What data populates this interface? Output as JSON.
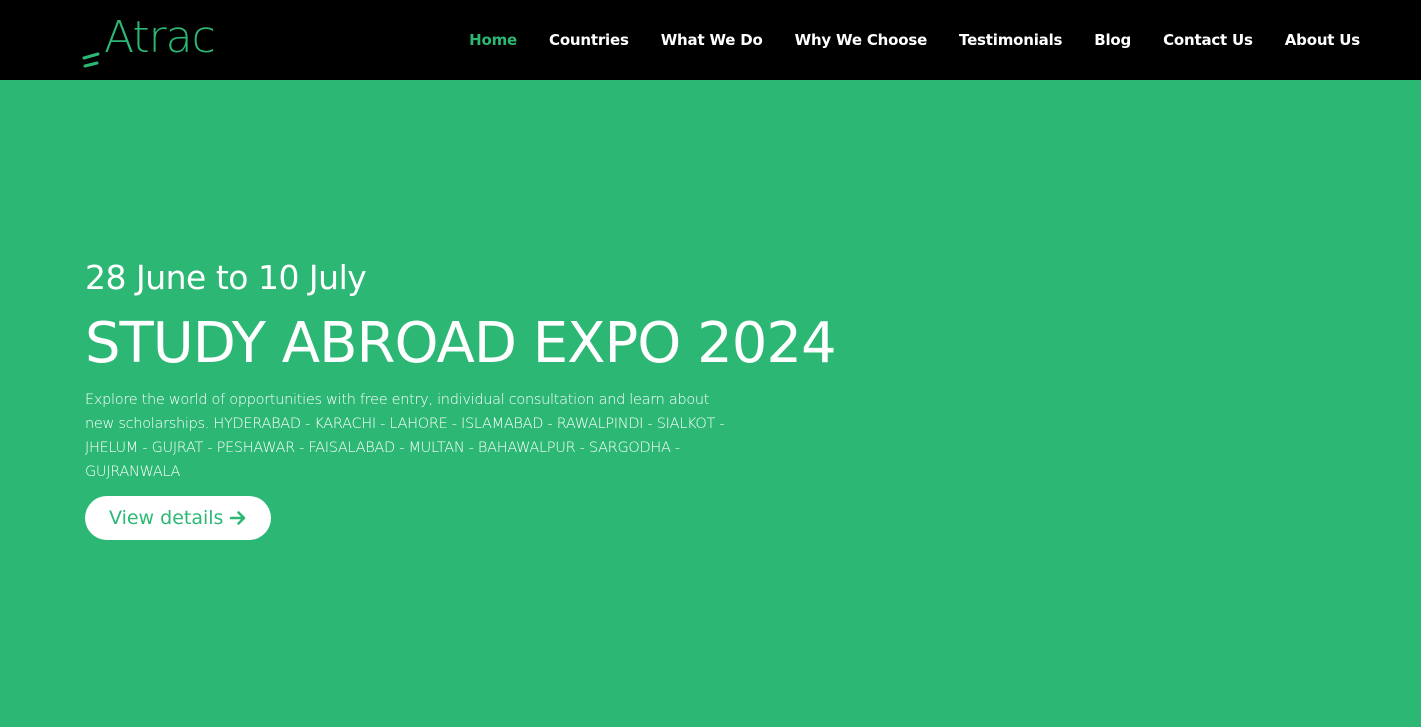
{
  "brand": {
    "logo_text": "Atrac",
    "color": "#2cb874"
  },
  "nav": {
    "items": [
      {
        "label": "Home",
        "active": true
      },
      {
        "label": "Countries",
        "active": false
      },
      {
        "label": "What We Do",
        "active": false
      },
      {
        "label": "Why We Choose",
        "active": false
      },
      {
        "label": "Testimonials",
        "active": false
      },
      {
        "label": "Blog",
        "active": false
      },
      {
        "label": "Contact Us",
        "active": false
      },
      {
        "label": "About Us",
        "active": false
      }
    ]
  },
  "hero": {
    "date": "28 June to 10 July",
    "title": "STUDY ABROAD EXPO 2024",
    "description": "Explore the world of opportunities with free entry, individual consultation and learn about new scholarships. HYDERABAD - KARACHI - LAHORE - ISLAMABAD - RAWALPINDI - SIALKOT - JHELUM - GUJRAT - PESHAWAR - FAISALABAD - MULTAN - BAHAWALPUR - SARGODHA - GUJRANWALA",
    "button_label": "View details",
    "button_icon": "arrow-right-icon"
  },
  "colors": {
    "background": "#2cb874",
    "navbar": "#000000",
    "text": "#ffffff"
  }
}
